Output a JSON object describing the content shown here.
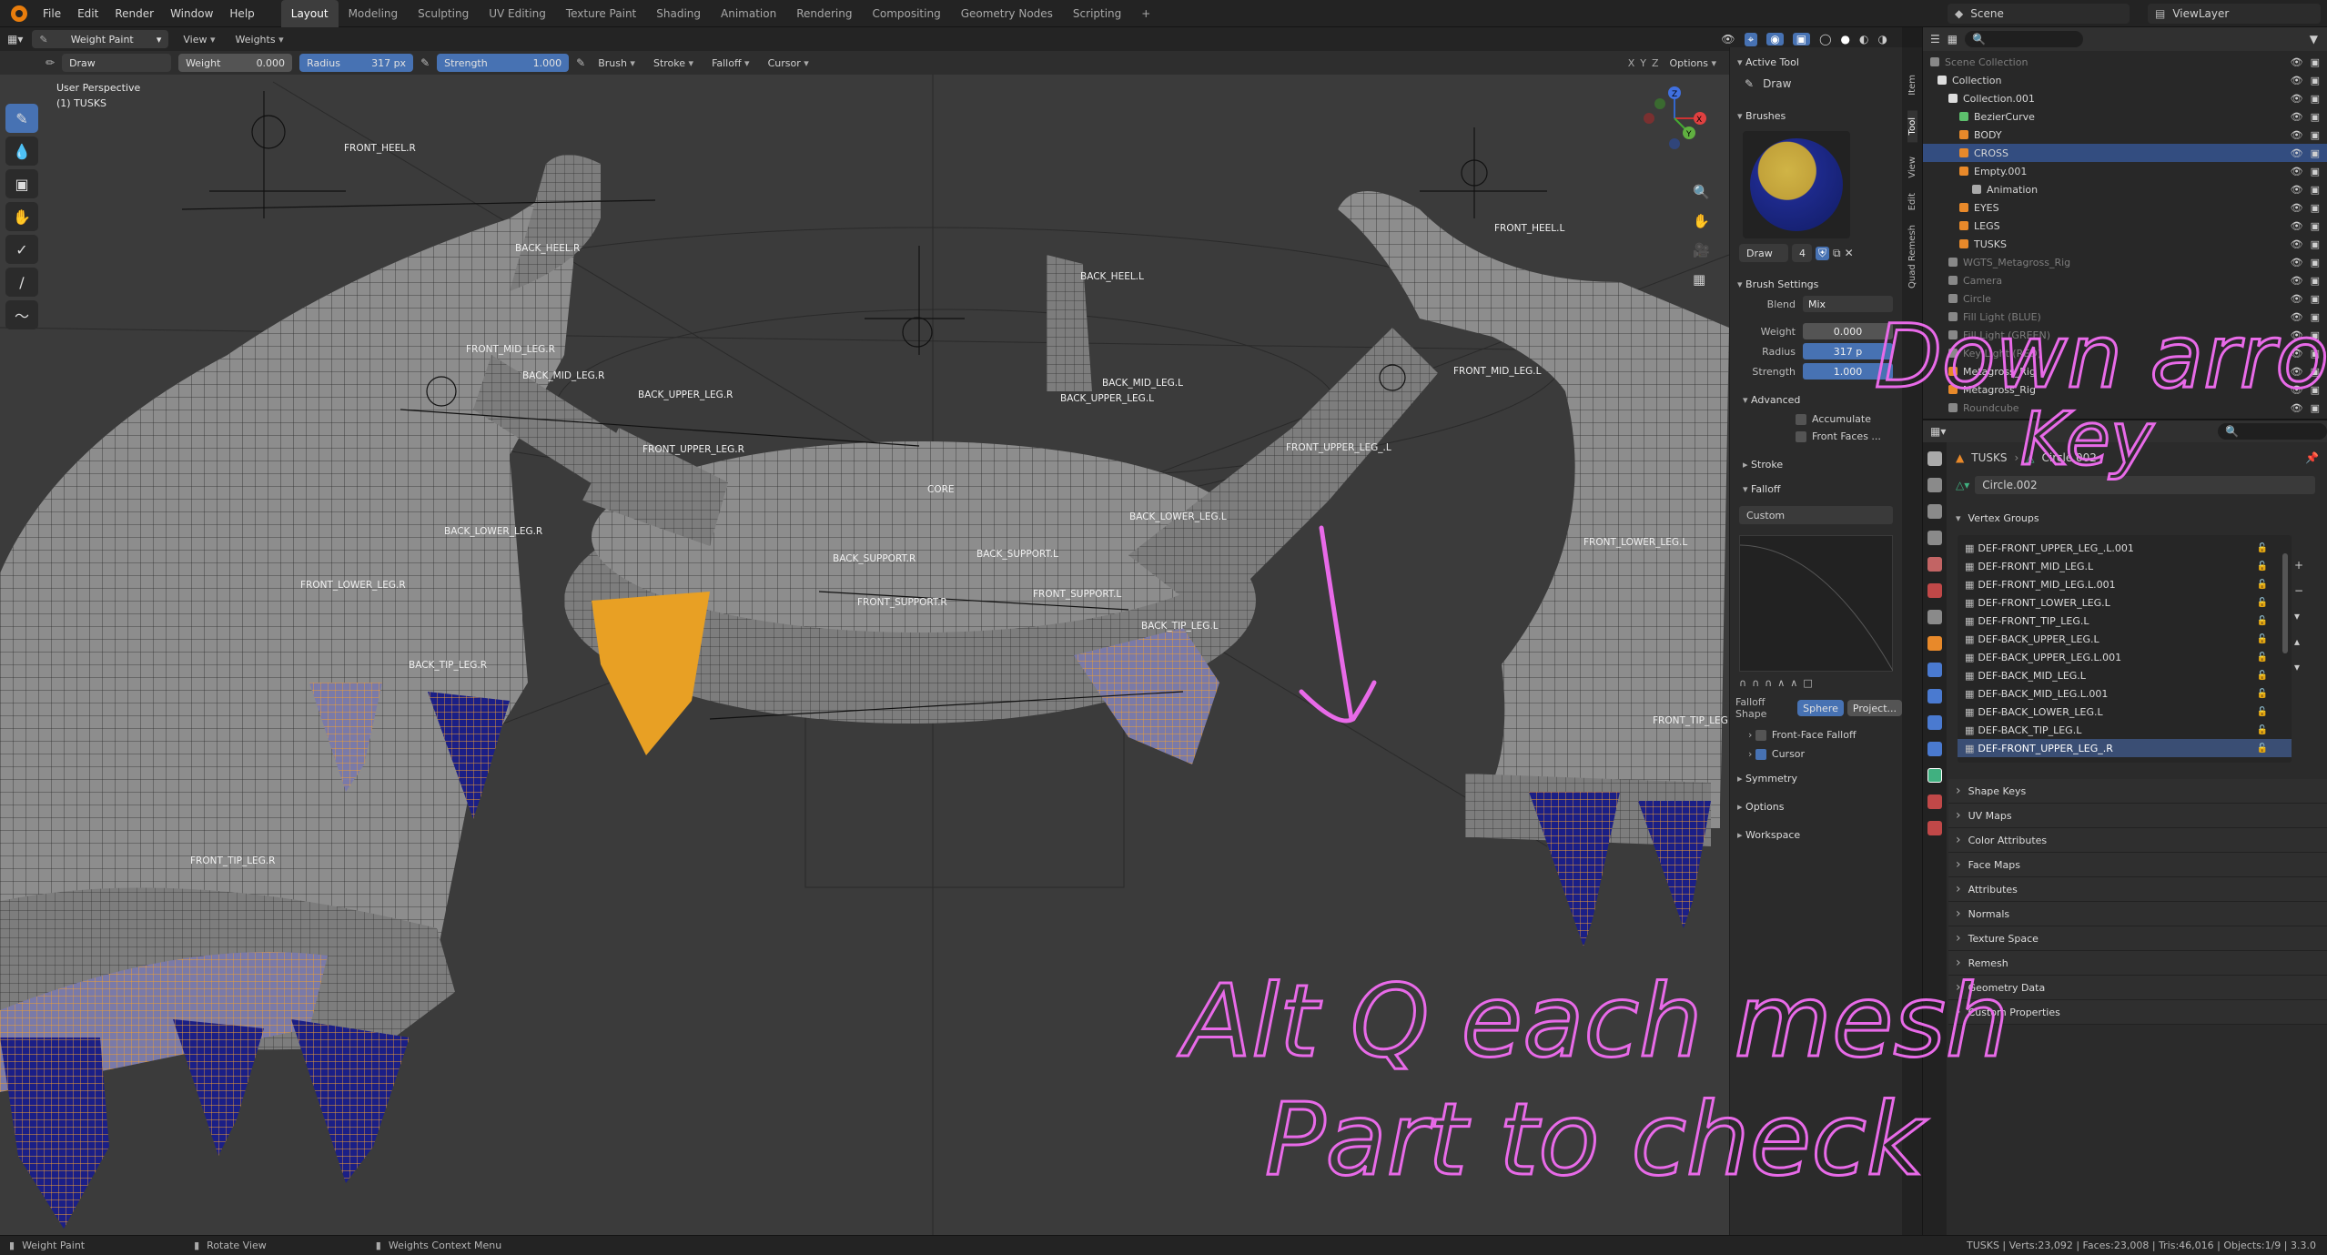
{
  "menu": [
    "File",
    "Edit",
    "Render",
    "Window",
    "Help"
  ],
  "workspaces": [
    "Layout",
    "Modeling",
    "Sculpting",
    "UV Editing",
    "Texture Paint",
    "Shading",
    "Animation",
    "Rendering",
    "Compositing",
    "Geometry Nodes",
    "Scripting"
  ],
  "active_workspace": "Layout",
  "scene_name": "Scene",
  "view_layer": "ViewLayer",
  "viewport": {
    "mode": "Weight Paint",
    "header_menus": [
      "View",
      "Weights"
    ],
    "tool": "Draw",
    "weight_label": "Weight",
    "weight_value": "0.000",
    "radius_label": "Radius",
    "radius_value": "317 px",
    "strength_label": "Strength",
    "strength_value": "1.000",
    "dropdowns": [
      "Brush",
      "Stroke",
      "Falloff",
      "Cursor"
    ],
    "options_label": "Options",
    "axes": [
      "X",
      "Y",
      "Z"
    ],
    "perspective": "User Perspective",
    "object": "(1) TUSKS"
  },
  "bones": [
    {
      "label": "FRONT_HEEL.R"
    },
    {
      "label": "BACK_HEEL.R"
    },
    {
      "label": "BACK_HEEL.L"
    },
    {
      "label": "FRONT_HEEL.L"
    },
    {
      "label": "FRONT_MID_LEG.R"
    },
    {
      "label": "BACK_MID_LEG.R"
    },
    {
      "label": "BACK_UPPER_LEG.R"
    },
    {
      "label": "BACK_MID_LEG.L"
    },
    {
      "label": "BACK_UPPER_LEG.L"
    },
    {
      "label": "FRONT_MID_LEG.L"
    },
    {
      "label": "FRONT_UPPER_LEG.R"
    },
    {
      "label": "FRONT_UPPER_LEG_.L"
    },
    {
      "label": "CORE"
    },
    {
      "label": "BACK_LOWER_LEG.R"
    },
    {
      "label": "BACK_LOWER_LEG.L"
    },
    {
      "label": "BACK_SUPPORT.R"
    },
    {
      "label": "BACK_SUPPORT.L"
    },
    {
      "label": "FRONT_SUPPORT.R"
    },
    {
      "label": "FRONT_SUPPORT.L"
    },
    {
      "label": "FRONT_LOWER_LEG.R"
    },
    {
      "label": "FRONT_LOWER_LEG.L"
    },
    {
      "label": "BACK_TIP_LEG.R"
    },
    {
      "label": "BACK_TIP_LEG.L"
    },
    {
      "label": "FRONT_TIP_LEG.R"
    },
    {
      "label": "FRONT_TIP_LEG."
    }
  ],
  "npanel": {
    "tabs": [
      "Item",
      "Tool",
      "View",
      "Edit",
      "Quad Remesh"
    ],
    "active_tool_title": "Active Tool",
    "active_tool": "Draw",
    "brushes_title": "Brushes",
    "brush_name": "Draw",
    "brush_users": "4",
    "brush_settings_title": "Brush Settings",
    "blend_label": "Blend",
    "blend_value": "Mix",
    "weight_label": "Weight",
    "weight_value": "0.000",
    "radius_label": "Radius",
    "radius_value": "317 p",
    "strength_label": "Strength",
    "strength_value": "1.000",
    "advanced_title": "Advanced",
    "accumulate_label": "Accumulate",
    "front_faces_label": "Front Faces ...",
    "stroke_title": "Stroke",
    "falloff_title": "Falloff",
    "falloff_preset": "Custom",
    "falloff_shape_label": "Falloff Shape",
    "falloff_shape_sphere": "Sphere",
    "falloff_shape_projected": "Project...",
    "front_face_falloff_label": "Front-Face Falloff",
    "cursor_label": "Cursor",
    "symmetry_title": "Symmetry",
    "options_title": "Options",
    "workspace_title": "Workspace"
  },
  "outliner": {
    "search_placeholder": "",
    "items": [
      {
        "label": "Scene Collection",
        "dim": true
      },
      {
        "label": "Collection"
      },
      {
        "label": "Collection.001"
      },
      {
        "label": "BezierCurve"
      },
      {
        "label": "BODY"
      },
      {
        "label": "CROSS",
        "selected": true
      },
      {
        "label": "Empty.001"
      },
      {
        "label": "Animation"
      },
      {
        "label": "EYES"
      },
      {
        "label": "LEGS"
      },
      {
        "label": "TUSKS"
      },
      {
        "label": "WGTS_Metagross_Rig",
        "dim": true
      },
      {
        "label": "Camera",
        "dim": true
      },
      {
        "label": "Circle",
        "dim": true
      },
      {
        "label": "Fill Light (BLUE)",
        "dim": true
      },
      {
        "label": "Fill Light (GREEN)",
        "dim": true
      },
      {
        "label": "Key Light (RED)",
        "dim": true
      },
      {
        "label": "Metagross_Rig"
      },
      {
        "label": "Metagross_Rig"
      },
      {
        "label": "Roundcube",
        "dim": true
      }
    ]
  },
  "properties": {
    "breadcrumb_object": "TUSKS",
    "breadcrumb_data": "Circle.002",
    "mesh_name": "Circle.002",
    "vertex_groups_title": "Vertex Groups",
    "vertex_groups": [
      "DEF-FRONT_UPPER_LEG_.L.001",
      "DEF-FRONT_MID_LEG.L",
      "DEF-FRONT_MID_LEG.L.001",
      "DEF-FRONT_LOWER_LEG.L",
      "DEF-FRONT_TIP_LEG.L",
      "DEF-BACK_UPPER_LEG.L",
      "DEF-BACK_UPPER_LEG.L.001",
      "DEF-BACK_MID_LEG.L",
      "DEF-BACK_MID_LEG.L.001",
      "DEF-BACK_LOWER_LEG.L",
      "DEF-BACK_TIP_LEG.L",
      "DEF-FRONT_UPPER_LEG_.R"
    ],
    "selected_vertex_group": "DEF-FRONT_UPPER_LEG_.R",
    "sections": [
      "Shape Keys",
      "UV Maps",
      "Color Attributes",
      "Face Maps",
      "Attributes",
      "Normals",
      "Texture Space",
      "Remesh",
      "Geometry Data",
      "Custom Properties"
    ]
  },
  "annotations": {
    "note1_line1": "Down arrow",
    "note1_line2": "Key",
    "note2_line1": "Alt Q each mesh",
    "note2_line2": "Part to check"
  },
  "statusbar": {
    "left_1": "Weight Paint",
    "left_2": "Rotate View",
    "left_3": "Weights Context Menu",
    "stats": "TUSKS | Verts:23,092 | Faces:23,008 | Tris:46,016 | Objects:1/9 | 3.3.0"
  },
  "colors": {
    "accent_blue": "#4772b3",
    "selected_row": "#334d80",
    "ink_pink": "#e86ae8",
    "wire_orange": "#f0a030",
    "paint_blue": "#1a1f8a"
  }
}
